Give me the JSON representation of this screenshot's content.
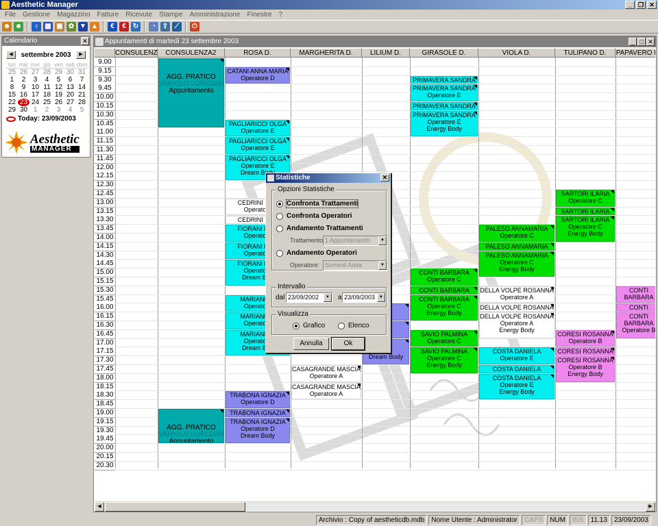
{
  "app": {
    "title": "Aesthetic Manager"
  },
  "menu": [
    "File",
    "Gestione",
    "Magazzino",
    "Fatture",
    "Ricevute",
    "Stampe",
    "Amministrazione",
    "Finestre",
    "?"
  ],
  "toolbar_icons": [
    {
      "name": "users-icon",
      "color": "#d08020",
      "glyph": "☻"
    },
    {
      "name": "user-add-icon",
      "color": "#40a040",
      "glyph": "☻"
    },
    {
      "name": "bottle-icon",
      "color": "#2060c0",
      "glyph": "♁"
    },
    {
      "name": "calendar-grid-icon",
      "color": "#3050b0",
      "glyph": "▦"
    },
    {
      "name": "note-icon",
      "color": "#c08030",
      "glyph": "▣"
    },
    {
      "name": "products-icon",
      "color": "#609030",
      "glyph": "✿"
    },
    {
      "name": "arrow-down-icon",
      "color": "#2040a0",
      "glyph": "▼"
    },
    {
      "name": "arrow-up-icon",
      "color": "#e08020",
      "glyph": "▲"
    },
    {
      "name": "euro-icon",
      "color": "#1050c0",
      "glyph": "€"
    },
    {
      "name": "euro-red-icon",
      "color": "#c02020",
      "glyph": "€"
    },
    {
      "name": "refresh-icon",
      "color": "#3070c0",
      "glyph": "↻"
    },
    {
      "name": "pie-chart-icon",
      "color": "#6080c0",
      "glyph": "◔"
    },
    {
      "name": "export-icon",
      "color": "#4070a0",
      "glyph": "⇪"
    },
    {
      "name": "line-chart-icon",
      "color": "#2060a0",
      "glyph": "⟋"
    },
    {
      "name": "power-icon",
      "color": "#d04020",
      "glyph": "⏻"
    }
  ],
  "calendar": {
    "caption": "Calendario",
    "month": "settembre 2003",
    "dow": [
      "lun",
      "mar",
      "mer",
      "gio",
      "ven",
      "sab",
      "dom"
    ],
    "days": [
      {
        "d": "25",
        "o": true
      },
      {
        "d": "26",
        "o": true
      },
      {
        "d": "27",
        "o": true
      },
      {
        "d": "28",
        "o": true
      },
      {
        "d": "29",
        "o": true
      },
      {
        "d": "30",
        "o": true
      },
      {
        "d": "31",
        "o": true
      },
      {
        "d": "1"
      },
      {
        "d": "2"
      },
      {
        "d": "3"
      },
      {
        "d": "4"
      },
      {
        "d": "5"
      },
      {
        "d": "6"
      },
      {
        "d": "7"
      },
      {
        "d": "8"
      },
      {
        "d": "9"
      },
      {
        "d": "10"
      },
      {
        "d": "11"
      },
      {
        "d": "12"
      },
      {
        "d": "13"
      },
      {
        "d": "14"
      },
      {
        "d": "15"
      },
      {
        "d": "16"
      },
      {
        "d": "17"
      },
      {
        "d": "18"
      },
      {
        "d": "19"
      },
      {
        "d": "20"
      },
      {
        "d": "21"
      },
      {
        "d": "22"
      },
      {
        "d": "23",
        "t": true
      },
      {
        "d": "24"
      },
      {
        "d": "25"
      },
      {
        "d": "26"
      },
      {
        "d": "27"
      },
      {
        "d": "28"
      },
      {
        "d": "29"
      },
      {
        "d": "30"
      },
      {
        "d": "1",
        "o": true
      },
      {
        "d": "2",
        "o": true
      },
      {
        "d": "3",
        "o": true
      },
      {
        "d": "4",
        "o": true
      },
      {
        "d": "5",
        "o": true
      }
    ],
    "today_label": "Today: 23/09/2003"
  },
  "logo": {
    "line1": "Aesthetic",
    "line2": "MANAGER"
  },
  "schedule": {
    "caption": "Appuntamenti di martedì 23 settembre 2003",
    "columns": [
      "CONSULENZA",
      "CONSULENZA2",
      "ROSA D.",
      "MARGHERITA D.",
      "LILIUM D.",
      "GIRASOLE D.",
      "VIOLA D.",
      "TULIPANO D.",
      "PAPAVERO D."
    ],
    "times": [
      "9.00",
      "9.15",
      "9.30",
      "9.45",
      "10.00",
      "10.15",
      "10.30",
      "10.45",
      "11.00",
      "11.15",
      "11.30",
      "11.45",
      "12.00",
      "12.15",
      "12.30",
      "12.45",
      "13.00",
      "13.15",
      "13.30",
      "13.45",
      "14.00",
      "14.15",
      "14.30",
      "14.45",
      "15.00",
      "15.15",
      "15.30",
      "15.45",
      "16.00",
      "16.15",
      "16.30",
      "16.45",
      "17.00",
      "17.15",
      "17.30",
      "17.45",
      "18.00",
      "18.15",
      "18.30",
      "18.45",
      "19.00",
      "19.15",
      "19.30",
      "19.45",
      "20.00",
      "20.15",
      "20.30"
    ],
    "appointments": [
      {
        "col": 1,
        "start": 0,
        "len": 8,
        "color": "#00aaaa",
        "lines": [
          {
            "t": "AGG. PRATICO"
          },
          {
            "t": "VARIOLO LOREDANA",
            "b": true
          },
          {
            "t": "Appuntamento"
          }
        ]
      },
      {
        "col": 1,
        "start": 40,
        "len": 4,
        "color": "#00aaaa",
        "lines": [
          {
            "t": "AGG. PRATICO"
          },
          {
            "t": "VARIOLO LOREDANA",
            "b": true
          },
          {
            "t": "Appuntamento"
          }
        ]
      },
      {
        "col": 2,
        "start": 1,
        "len": 2,
        "color": "#8888ee",
        "lines": [
          {
            "t": "CATANI ANNA MARIA"
          },
          {
            "t": "Operatore D"
          }
        ]
      },
      {
        "col": 2,
        "start": 7,
        "len": 2,
        "color": "#00eeee",
        "lines": [
          {
            "t": "PAGLIARICCI OLGA"
          },
          {
            "t": "Operatore E"
          }
        ]
      },
      {
        "col": 2,
        "start": 9,
        "len": 2,
        "color": "#00eeee",
        "lines": [
          {
            "t": "PAGLIARICCI OLGA"
          },
          {
            "t": "Operatore E"
          }
        ]
      },
      {
        "col": 2,
        "start": 11,
        "len": 3,
        "color": "#00eeee",
        "lines": [
          {
            "t": "PAGLIARICCI OLGA"
          },
          {
            "t": "Operatore E"
          },
          {
            "t": "Dream Body"
          }
        ]
      },
      {
        "col": 2,
        "start": 16,
        "len": 2,
        "color": "#ffffff",
        "lines": [
          {
            "t": "CEDRINI DAN"
          },
          {
            "t": "Operatore"
          }
        ]
      },
      {
        "col": 2,
        "start": 18,
        "len": 1,
        "color": "#ffffff",
        "lines": [
          {
            "t": "CEDRINI DAN"
          }
        ]
      },
      {
        "col": 2,
        "start": 19,
        "len": 2,
        "color": "#00eeee",
        "lines": [
          {
            "t": "FIORANI MAR"
          },
          {
            "t": "Operatore"
          }
        ]
      },
      {
        "col": 2,
        "start": 21,
        "len": 2,
        "color": "#00eeee",
        "lines": [
          {
            "t": "FIORANI MAR"
          },
          {
            "t": "Operatore"
          }
        ]
      },
      {
        "col": 2,
        "start": 23,
        "len": 3,
        "color": "#00eeee",
        "lines": [
          {
            "t": "FIORANI MAR"
          },
          {
            "t": "Operatore"
          },
          {
            "t": "Dream Bod"
          }
        ]
      },
      {
        "col": 2,
        "start": 27,
        "len": 2,
        "color": "#00eeee",
        "lines": [
          {
            "t": "MARIANI EL"
          },
          {
            "t": "Operatore"
          }
        ]
      },
      {
        "col": 2,
        "start": 29,
        "len": 2,
        "color": "#00eeee",
        "lines": [
          {
            "t": "MARIANI EL"
          },
          {
            "t": "Operatore"
          }
        ]
      },
      {
        "col": 2,
        "start": 31,
        "len": 3,
        "color": "#00eeee",
        "lines": [
          {
            "t": "MARIANI EL"
          },
          {
            "t": "Operatore"
          },
          {
            "t": "Dream Bod"
          }
        ]
      },
      {
        "col": 2,
        "start": 38,
        "len": 2,
        "color": "#8888ee",
        "lines": [
          {
            "t": "TRABONA IGNAZIA"
          },
          {
            "t": "Operatore D"
          }
        ]
      },
      {
        "col": 2,
        "start": 40,
        "len": 1,
        "color": "#8888ee",
        "lines": [
          {
            "t": "TRABONA IGNAZIA"
          }
        ]
      },
      {
        "col": 2,
        "start": 41,
        "len": 3,
        "color": "#8888ee",
        "lines": [
          {
            "t": "TRABONA IGNAZIA"
          },
          {
            "t": "Operatore D"
          },
          {
            "t": "Dream Body"
          }
        ]
      },
      {
        "col": 3,
        "start": 35,
        "len": 2,
        "color": "#ffffff",
        "lines": [
          {
            "t": "CASAGRANDE MASCIA"
          },
          {
            "t": "Operatore A"
          }
        ]
      },
      {
        "col": 3,
        "start": 37,
        "len": 2,
        "color": "#ffffff",
        "lines": [
          {
            "t": "CASAGRANDE MASCIA"
          },
          {
            "t": "Operatore A"
          }
        ]
      },
      {
        "col": 4,
        "start": 28,
        "len": 2,
        "color": "#8888ee",
        "lines": [
          {
            "t": "ZIA"
          },
          {
            "t": "e D"
          }
        ]
      },
      {
        "col": 4,
        "start": 30,
        "len": 2,
        "color": "#8888ee",
        "lines": [
          {
            "t": "ZIA"
          },
          {
            "t": "e D"
          }
        ]
      },
      {
        "col": 4,
        "start": 32,
        "len": 3,
        "color": "#8888ee",
        "lines": [
          {
            "t": "ZIA"
          },
          {
            "t": "e D"
          },
          {
            "t": "Dream Body"
          }
        ]
      },
      {
        "col": 5,
        "start": 2,
        "len": 1,
        "color": "#00eeee",
        "lines": [
          {
            "t": "PRIMAVERA SANDRA"
          }
        ]
      },
      {
        "col": 5,
        "start": 3,
        "len": 2,
        "color": "#00eeee",
        "lines": [
          {
            "t": "PRIMAVERA SANDRA"
          },
          {
            "t": "Operatore E"
          }
        ]
      },
      {
        "col": 5,
        "start": 5,
        "len": 1,
        "color": "#00eeee",
        "lines": [
          {
            "t": "PRIMAVERA SANDRA"
          }
        ]
      },
      {
        "col": 5,
        "start": 6,
        "len": 3,
        "color": "#00eeee",
        "lines": [
          {
            "t": "PRIMAVERA SANDRA"
          },
          {
            "t": "Operatore E"
          },
          {
            "t": "Energy Body"
          }
        ]
      },
      {
        "col": 5,
        "start": 24,
        "len": 2,
        "color": "#00dd00",
        "lines": [
          {
            "t": "CONTI BARBARA"
          },
          {
            "t": "Operatore C"
          }
        ]
      },
      {
        "col": 5,
        "start": 26,
        "len": 1,
        "color": "#00dd00",
        "lines": [
          {
            "t": "CONTI BARBARA"
          }
        ]
      },
      {
        "col": 5,
        "start": 27,
        "len": 3,
        "color": "#00dd00",
        "lines": [
          {
            "t": "CONTI BARBARA"
          },
          {
            "t": "Operatore C"
          },
          {
            "t": "Energy Body"
          }
        ]
      },
      {
        "col": 5,
        "start": 31,
        "len": 2,
        "color": "#00dd00",
        "lines": [
          {
            "t": "SAVIO PALMINA"
          },
          {
            "t": "Operatore C"
          }
        ]
      },
      {
        "col": 5,
        "start": 33,
        "len": 3,
        "color": "#00dd00",
        "lines": [
          {
            "t": "SAVIO PALMINA"
          },
          {
            "t": "Operatore C"
          },
          {
            "t": "Energy Body"
          }
        ]
      },
      {
        "col": 6,
        "start": 19,
        "len": 2,
        "color": "#00dd00",
        "lines": [
          {
            "t": "PALESO ANNAMARIA"
          },
          {
            "t": "Operatore C"
          }
        ]
      },
      {
        "col": 6,
        "start": 21,
        "len": 1,
        "color": "#00dd00",
        "lines": [
          {
            "t": "PALESO ANNAMARIA"
          }
        ]
      },
      {
        "col": 6,
        "start": 22,
        "len": 3,
        "color": "#00dd00",
        "lines": [
          {
            "t": "PALESO ANNAMARIA"
          },
          {
            "t": "Operatore C"
          },
          {
            "t": "Energy Body"
          }
        ]
      },
      {
        "col": 6,
        "start": 26,
        "len": 2,
        "color": "#ffffff",
        "lines": [
          {
            "t": "DELLA VOLPE ROSANNA"
          },
          {
            "t": "Operatore A"
          }
        ]
      },
      {
        "col": 6,
        "start": 28,
        "len": 1,
        "color": "#ffffff",
        "lines": [
          {
            "t": "DELLA VOLPE ROSANNA"
          }
        ]
      },
      {
        "col": 6,
        "start": 29,
        "len": 3,
        "color": "#ffffff",
        "lines": [
          {
            "t": "DELLA VOLPE ROSANNA"
          },
          {
            "t": "Operatore A"
          },
          {
            "t": "Energy Body"
          }
        ]
      },
      {
        "col": 6,
        "start": 33,
        "len": 2,
        "color": "#00eeee",
        "lines": [
          {
            "t": "COSTA DANIELA"
          },
          {
            "t": "Operatore E"
          }
        ]
      },
      {
        "col": 6,
        "start": 35,
        "len": 1,
        "color": "#00eeee",
        "lines": [
          {
            "t": "COSTA DANIELA"
          }
        ]
      },
      {
        "col": 6,
        "start": 36,
        "len": 3,
        "color": "#00eeee",
        "lines": [
          {
            "t": "COSTA DANIELA"
          },
          {
            "t": "Operatore E"
          },
          {
            "t": "Energy Body"
          }
        ]
      },
      {
        "col": 7,
        "start": 15,
        "len": 2,
        "color": "#00dd00",
        "lines": [
          {
            "t": "SARTORI ILARIA"
          },
          {
            "t": "Operatore C"
          }
        ]
      },
      {
        "col": 7,
        "start": 17,
        "len": 1,
        "color": "#00dd00",
        "lines": [
          {
            "t": "SARTORI ILARIA"
          }
        ]
      },
      {
        "col": 7,
        "start": 18,
        "len": 3,
        "color": "#00dd00",
        "lines": [
          {
            "t": "SARTORI ILARIA"
          },
          {
            "t": "Operatore C"
          },
          {
            "t": "Energy Body"
          }
        ]
      },
      {
        "col": 7,
        "start": 31,
        "len": 2,
        "color": "#ee88ee",
        "lines": [
          {
            "t": "CORESI ROSANNA"
          },
          {
            "t": "Operatore B"
          }
        ]
      },
      {
        "col": 7,
        "start": 33,
        "len": 1,
        "color": "#ee88ee",
        "lines": [
          {
            "t": "CORESI ROSANNA"
          }
        ]
      },
      {
        "col": 7,
        "start": 34,
        "len": 3,
        "color": "#ee88ee",
        "lines": [
          {
            "t": "CORESI ROSANNA"
          },
          {
            "t": "Operatore B"
          },
          {
            "t": "Energy Body"
          }
        ]
      },
      {
        "col": 8,
        "start": 26,
        "len": 2,
        "color": "#ee88ee",
        "lines": [
          {
            "t": "CONTI"
          },
          {
            "t": "BARBARA"
          }
        ]
      },
      {
        "col": 8,
        "start": 28,
        "len": 1,
        "color": "#ee88ee",
        "lines": [
          {
            "t": "CONTI"
          }
        ]
      },
      {
        "col": 8,
        "start": 29,
        "len": 3,
        "color": "#ee88ee",
        "lines": [
          {
            "t": "CONTI"
          },
          {
            "t": "BARBARA"
          },
          {
            "t": "Operatore B"
          }
        ]
      }
    ]
  },
  "dialog": {
    "title": "Statistiche",
    "options_group": "Opzioni Statistiche",
    "opt1": "Confronta Trattamenti",
    "opt2": "Confronta Operatori",
    "opt3": "Andamento Trattamenti",
    "trattamento_label": "Trattamento:",
    "trattamento_value": "1 Appuntamento",
    "opt4": "Andamento Operatori",
    "operatore_label": "Operatore:",
    "operatore_value": "Sorrenti Anita",
    "interval_group": "Intervallo",
    "dal_label": "dal",
    "dal_value": "23/09/2002",
    "al_label": "al",
    "al_value": "23/09/2003",
    "view_group": "Visualizza",
    "view1": "Grafico",
    "view2": "Elenco",
    "cancel": "Annulla",
    "ok": "Ok"
  },
  "status": {
    "archive": "Archivio : Copy of aestheticdb.mdb",
    "user": "Nome Utente : Administrator",
    "caps": "CAPS",
    "num": "NUM",
    "ins": "INS",
    "time": "11.13",
    "date": "23/09/2003"
  }
}
